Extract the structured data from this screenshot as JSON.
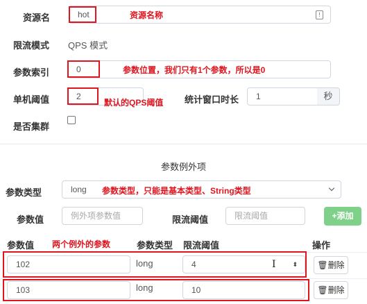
{
  "form": {
    "resource_name": {
      "label": "资源名",
      "value": "hot",
      "annotation": "资源名称"
    },
    "limit_mode": {
      "label": "限流模式",
      "value": "QPS 模式"
    },
    "param_index": {
      "label": "参数索引",
      "value": "0",
      "annotation": "参数位置，我们只有1个参数，所以是0"
    },
    "threshold": {
      "label": "单机阈值",
      "value": "2",
      "annotation": "默认的QPS阈值"
    },
    "window": {
      "label": "统计窗口时长",
      "value": "1",
      "unit": "秒"
    },
    "cluster": {
      "label": "是否集群"
    }
  },
  "exceptions": {
    "section_title": "参数例外项",
    "param_type": {
      "label": "参数类型",
      "value": "long",
      "annotation": "参数类型，只能是基本类型、String类型"
    },
    "param_value": {
      "label": "参数值",
      "placeholder": "例外项参数值"
    },
    "limit_threshold": {
      "label": "限流阈值",
      "placeholder": "限流阈值"
    },
    "add_label": "添加",
    "table": {
      "headers": [
        "参数值",
        "参数类型",
        "限流阈值",
        "操作"
      ],
      "annotation": "两个例外的参数",
      "rows": [
        {
          "value": "102",
          "type": "long",
          "threshold": "4",
          "action": "删除"
        },
        {
          "value": "103",
          "type": "long",
          "threshold": "10",
          "action": "删除"
        }
      ]
    }
  },
  "colors": {
    "annotation_red": "#e0141e",
    "add_button_green": "#7fd18a"
  }
}
